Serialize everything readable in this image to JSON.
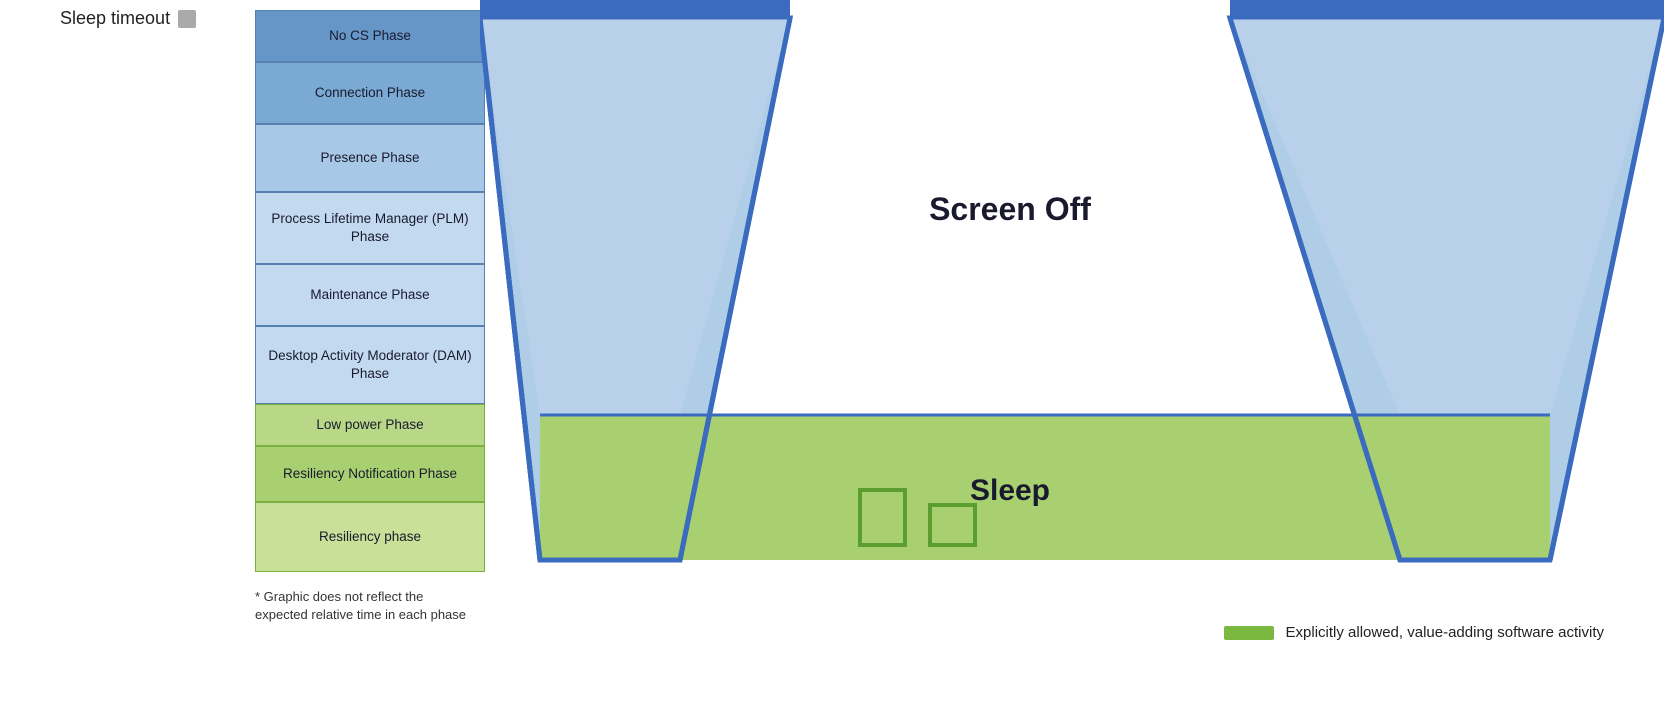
{
  "header": {
    "sleep_timeout_label": "Sleep timeout"
  },
  "phases": [
    {
      "id": "no-cs",
      "label": "No CS Phase",
      "color_class": "phase-blue-dark",
      "height_class": "ph-no-cs"
    },
    {
      "id": "connection",
      "label": "Connection Phase",
      "color_class": "phase-blue-mid",
      "height_class": "ph-connection"
    },
    {
      "id": "presence",
      "label": "Presence Phase",
      "color_class": "phase-blue-light",
      "height_class": "ph-presence"
    },
    {
      "id": "plm",
      "label": "Process Lifetime Manager (PLM) Phase",
      "color_class": "phase-blue-lighter",
      "height_class": "ph-plm"
    },
    {
      "id": "maintenance",
      "label": "Maintenance Phase",
      "color_class": "phase-blue-lighter",
      "height_class": "ph-maintenance"
    },
    {
      "id": "dam",
      "label": "Desktop Activity Moderator (DAM) Phase",
      "color_class": "phase-blue-lighter",
      "height_class": "ph-dam"
    },
    {
      "id": "lowpower",
      "label": "Low power Phase",
      "color_class": "phase-green-light",
      "height_class": "ph-lowpower"
    },
    {
      "id": "resnotif",
      "label": "Resiliency Notification Phase",
      "color_class": "phase-green-mid",
      "height_class": "ph-resnotif"
    },
    {
      "id": "resiliency",
      "label": "Resiliency phase",
      "color_class": "phase-green-lighter",
      "height_class": "ph-resiliency"
    }
  ],
  "footnote": "* Graphic does not reflect the expected relative time in each phase",
  "diagram": {
    "screen_off_label": "Screen Off",
    "sleep_label": "Sleep"
  },
  "legend": {
    "bar_label": "Explicitly allowed, value-adding software activity"
  }
}
